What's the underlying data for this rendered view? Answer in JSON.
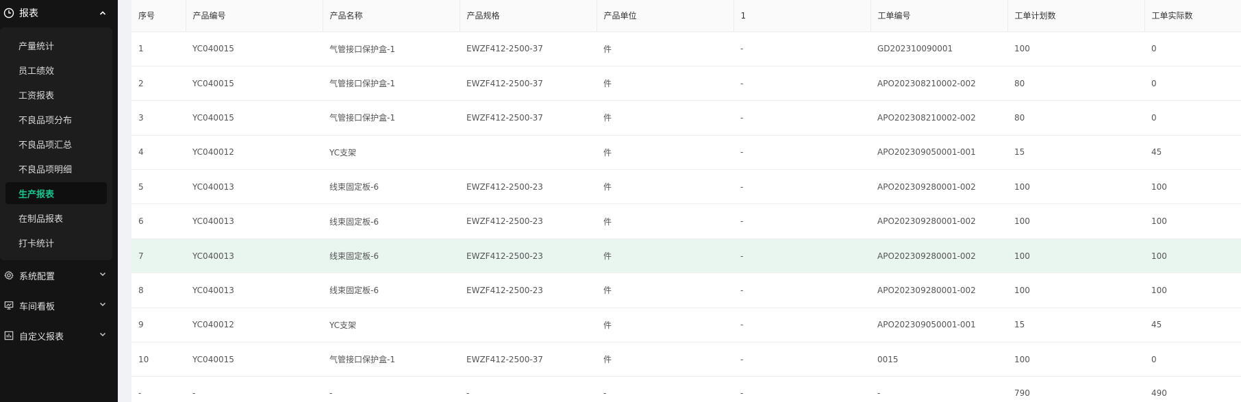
{
  "sidebar": {
    "section_title": "报表",
    "items": [
      {
        "label": "产量统计"
      },
      {
        "label": "员工绩效"
      },
      {
        "label": "工资报表"
      },
      {
        "label": "不良品项分布"
      },
      {
        "label": "不良品项汇总"
      },
      {
        "label": "不良品项明细"
      },
      {
        "label": "生产报表",
        "active": true
      },
      {
        "label": "在制品报表"
      },
      {
        "label": "打卡统计"
      }
    ],
    "groups": [
      {
        "label": "系统配置",
        "icon": "gear-icon"
      },
      {
        "label": "车间看板",
        "icon": "monitor-icon"
      },
      {
        "label": "自定义报表",
        "icon": "chart-icon"
      }
    ],
    "active_color": "#19c38e"
  },
  "table": {
    "columns": [
      "序号",
      "产品编号",
      "产品名称",
      "产品规格",
      "产品单位",
      "1",
      "工单编号",
      "工单计划数",
      "工单实际数"
    ],
    "rows": [
      [
        "1",
        "YC040015",
        "气管接口保护盒-1",
        "EWZF412-2500-37",
        "件",
        "-",
        "GD202310090001",
        "100",
        "0"
      ],
      [
        "2",
        "YC040015",
        "气管接口保护盒-1",
        "EWZF412-2500-37",
        "件",
        "-",
        "APO202308210002-002",
        "80",
        "0"
      ],
      [
        "3",
        "YC040015",
        "气管接口保护盒-1",
        "EWZF412-2500-37",
        "件",
        "-",
        "APO202308210002-002",
        "80",
        "0"
      ],
      [
        "4",
        "YC040012",
        "YC支架",
        "",
        "件",
        "-",
        "APO202309050001-001",
        "15",
        "45"
      ],
      [
        "5",
        "YC040013",
        "线束固定板-6",
        "EWZF412-2500-23",
        "件",
        "-",
        "APO202309280001-002",
        "100",
        "100"
      ],
      [
        "6",
        "YC040013",
        "线束固定板-6",
        "EWZF412-2500-23",
        "件",
        "-",
        "APO202309280001-002",
        "100",
        "100"
      ],
      [
        "7",
        "YC040013",
        "线束固定板-6",
        "EWZF412-2500-23",
        "件",
        "-",
        "APO202309280001-002",
        "100",
        "100"
      ],
      [
        "8",
        "YC040013",
        "线束固定板-6",
        "EWZF412-2500-23",
        "件",
        "-",
        "APO202309280001-002",
        "100",
        "100"
      ],
      [
        "9",
        "YC040012",
        "YC支架",
        "",
        "件",
        "-",
        "APO202309050001-001",
        "15",
        "45"
      ],
      [
        "10",
        "YC040015",
        "气管接口保护盒-1",
        "EWZF412-2500-37",
        "件",
        "-",
        "0015",
        "100",
        "0"
      ]
    ],
    "summary": [
      "-",
      "-",
      "-",
      "-",
      "-",
      "-",
      "-",
      "790",
      "490"
    ],
    "highlight_row": 7,
    "highlight_color": "#e9f6f0"
  }
}
